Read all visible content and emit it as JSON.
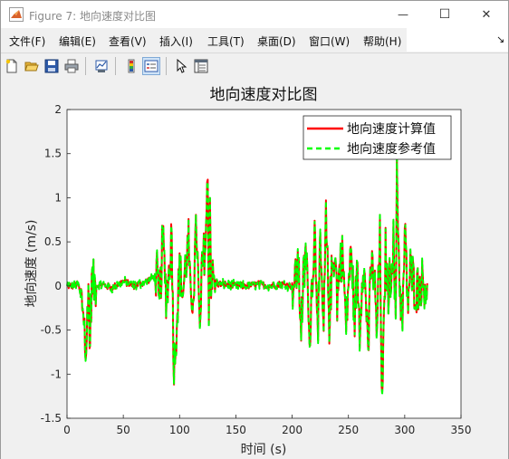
{
  "window": {
    "title": "Figure 7: 地向速度对比图",
    "controls": {
      "minimize": "—",
      "maximize": "☐",
      "close": "✕"
    }
  },
  "menubar": {
    "items": [
      {
        "label": "文件(F)"
      },
      {
        "label": "编辑(E)"
      },
      {
        "label": "查看(V)"
      },
      {
        "label": "插入(I)"
      },
      {
        "label": "工具(T)"
      },
      {
        "label": "桌面(D)"
      },
      {
        "label": "窗口(W)"
      },
      {
        "label": "帮助(H)"
      }
    ],
    "overflow_icon": "dock-arrow-icon"
  },
  "toolbar": {
    "buttons": [
      "new-figure-icon",
      "open-file-icon",
      "save-icon",
      "print-icon",
      "link-plot-icon",
      "insert-colorbar-icon",
      "insert-legend-icon",
      "edit-plot-pointer-icon",
      "property-inspector-icon"
    ]
  },
  "colors": {
    "calc_line": "#ff0000",
    "ref_line": "#00ff00",
    "axes_bg": "#ffffff",
    "figure_bg": "#f0f0f0"
  },
  "chart_data": {
    "type": "line",
    "title": "地向速度对比图",
    "xlabel": "时间 (s)",
    "ylabel": "地向速度 (m/s)",
    "xlim": [
      0,
      350
    ],
    "ylim": [
      -1.5,
      2
    ],
    "xticks": [
      "0",
      "50",
      "100",
      "150",
      "200",
      "250",
      "300",
      "350"
    ],
    "yticks": [
      "-1.5",
      "-1",
      "-0.5",
      "0",
      "0.5",
      "1",
      "1.5",
      "2"
    ],
    "grid": false,
    "legend_position": "top-right",
    "series": [
      {
        "name": "地向速度计算值",
        "style": "solid",
        "color": "#ff0000"
      },
      {
        "name": "地向速度参考值",
        "style": "dashed",
        "color": "#00ff00"
      }
    ],
    "x": [
      0,
      5,
      10,
      15,
      17,
      18,
      19,
      20,
      22,
      25,
      30,
      40,
      50,
      60,
      70,
      80,
      82,
      85,
      88,
      90,
      93,
      95,
      97,
      100,
      103,
      105,
      108,
      110,
      113,
      115,
      118,
      120,
      123,
      125,
      126,
      127,
      128,
      130,
      135,
      140,
      150,
      160,
      170,
      180,
      190,
      200,
      203,
      205,
      208,
      210,
      213,
      215,
      218,
      220,
      223,
      225,
      228,
      230,
      233,
      235,
      238,
      240,
      243,
      245,
      248,
      250,
      253,
      255,
      258,
      260,
      263,
      265,
      268,
      270,
      273,
      275,
      278,
      280,
      283,
      285,
      288,
      290,
      292,
      293,
      295,
      298,
      300,
      303,
      305,
      310,
      315,
      320
    ],
    "values": [
      0,
      0,
      0.02,
      -0.3,
      -0.95,
      -0.3,
      0.05,
      -0.7,
      0.05,
      0,
      0.02,
      -0.02,
      0.05,
      0,
      0.05,
      0.12,
      -0.3,
      0.55,
      -0.1,
      0.05,
      0.6,
      -0.95,
      -0.5,
      0.2,
      -0.1,
      0.2,
      0.5,
      -0.3,
      0.1,
      0.7,
      -0.6,
      0.2,
      0.5,
      1.15,
      -0.2,
      0.95,
      0.1,
      0.05,
      0.02,
      0.02,
      0,
      0,
      0.02,
      0,
      0.02,
      0,
      0.05,
      0.3,
      -0.45,
      0.05,
      0.4,
      -0.7,
      0.15,
      0.6,
      -0.35,
      0.35,
      -0.55,
      0.75,
      -0.4,
      0.1,
      0.45,
      -0.15,
      0.3,
      0.35,
      -0.5,
      0.05,
      0.4,
      -0.4,
      0.15,
      -0.5,
      0.35,
      -0.1,
      -0.65,
      0.2,
      0.15,
      -0.6,
      0.55,
      -1.45,
      0.4,
      -0.1,
      0.2,
      0.5,
      -0.5,
      1.45,
      0.2,
      -0.5,
      0.6,
      -0.2,
      0.2,
      -0.05,
      0.05,
      0.02
    ]
  }
}
